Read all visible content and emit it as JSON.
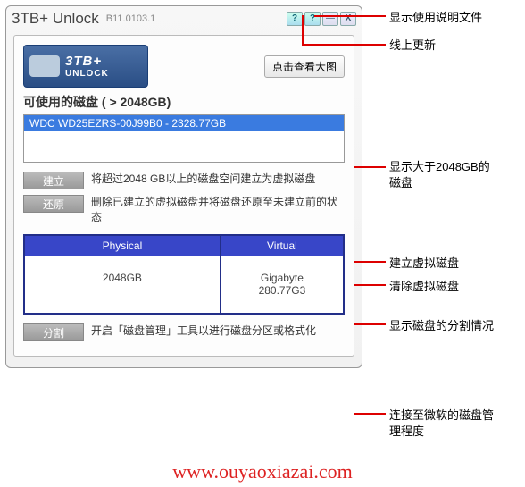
{
  "window": {
    "title": "3TB+ Unlock",
    "version": "B11.0103.1",
    "help_label": "?",
    "update_label": "?",
    "min_label": "—",
    "close_label": "X"
  },
  "logo": {
    "line1": "3TB+",
    "line2": "UNLOCK"
  },
  "big_image_button": "点击查看大图",
  "section_title": "可使用的磁盘 ( > 2048GB)",
  "disk_row": "WDC WD25EZRS-00J99B0 - 2328.77GB",
  "actions": {
    "create": {
      "label": "建立",
      "desc": "将超过2048 GB以上的磁盘空间建立为虚拟磁盘"
    },
    "restore": {
      "label": "还原",
      "desc": "删除已建立的虚拟磁盘并将磁盘还原至未建立前的状态"
    },
    "partition": {
      "label": "分割",
      "desc": "开启「磁盘管理」工具以进行磁盘分区或格式化"
    }
  },
  "table": {
    "physical_header": "Physical",
    "virtual_header": "Virtual",
    "physical_value": "2048GB",
    "virtual_label": "Gigabyte",
    "virtual_value": "280.77G3"
  },
  "annotations": {
    "help": "显示使用说明文件",
    "update": "线上更新",
    "disklist1": "显示大于2048GB的",
    "disklist2": "磁盘",
    "create": "建立虚拟磁盘",
    "restore": "清除虚拟磁盘",
    "table": "显示磁盘的分割情况",
    "partition1": "连接至微软的磁盘管",
    "partition2": "理程度"
  },
  "watermark": "www.ouyaoxiazai.com"
}
